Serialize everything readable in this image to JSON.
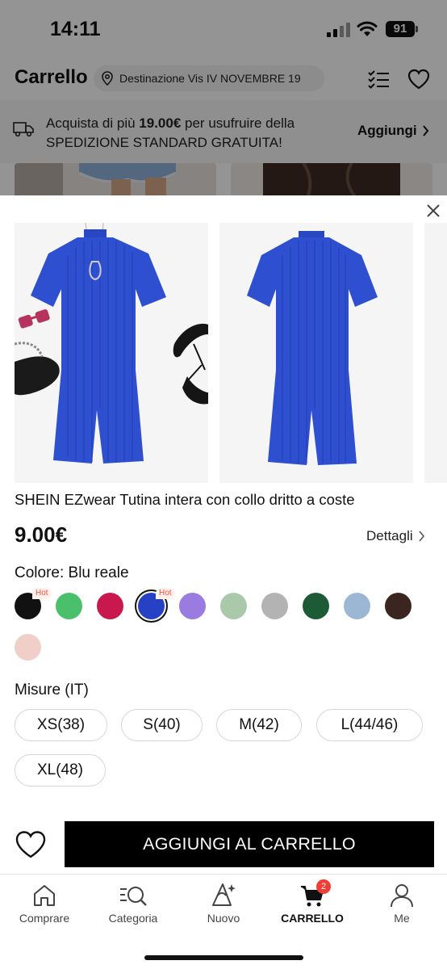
{
  "status": {
    "time": "14:11",
    "battery": "91"
  },
  "header": {
    "title": "Carrello",
    "destination": "Destinazione Vis IV NOVEMBRE 19"
  },
  "shipping": {
    "line1_prefix": "Acquista di più ",
    "line1_amount": "19.00€",
    "line1_suffix": " per usufruire della",
    "line2": "SPEDIZIONE STANDARD GRATUITA!",
    "action": "Aggiungi"
  },
  "product": {
    "title": "SHEIN EZwear Tutina intera con collo dritto a coste",
    "price": "9.00€",
    "details_label": "Dettagli",
    "color_label": "Colore: Blu reale",
    "hot_label": "Hot",
    "colors": [
      {
        "name": "black",
        "hex": "#111111",
        "hot": true
      },
      {
        "name": "green",
        "hex": "#4bc06b",
        "hot": false
      },
      {
        "name": "raspberry",
        "hex": "#c8184e",
        "hot": false
      },
      {
        "name": "royal-blue",
        "hex": "#2741c4",
        "hot": true,
        "selected": true
      },
      {
        "name": "lavender",
        "hex": "#9a7be0",
        "hot": false
      },
      {
        "name": "sage",
        "hex": "#a9c9aa",
        "hot": false
      },
      {
        "name": "heather-grey",
        "hex": "#b3b3b3",
        "hot": false
      },
      {
        "name": "dark-green",
        "hex": "#1d5a36",
        "hot": false
      },
      {
        "name": "dusty-blue",
        "hex": "#9bb7d4",
        "hot": false
      },
      {
        "name": "dark-brown",
        "hex": "#3a2520",
        "hot": false
      },
      {
        "name": "light-pink",
        "hex": "#f0cfc9",
        "hot": false
      }
    ],
    "size_label": "Misure (IT)",
    "sizes": [
      "XS(38)",
      "S(40)",
      "M(42)",
      "L(44/46)",
      "XL(48)"
    ],
    "add_to_cart": "AGGIUNGI AL CARRELLO"
  },
  "tabs": [
    {
      "label": "Comprare",
      "icon": "home-icon"
    },
    {
      "label": "Categoria",
      "icon": "category-search-icon"
    },
    {
      "label": "Nuovo",
      "icon": "new-sparkle-icon"
    },
    {
      "label": "CARRELLO",
      "icon": "cart-icon",
      "active": true,
      "badge": "2"
    },
    {
      "label": "Me",
      "icon": "profile-icon"
    }
  ],
  "colors": {
    "accent": "#000000",
    "badge": "#ef3e36",
    "hot_text": "#f0523a",
    "product_blue": "#2f4fd1"
  }
}
